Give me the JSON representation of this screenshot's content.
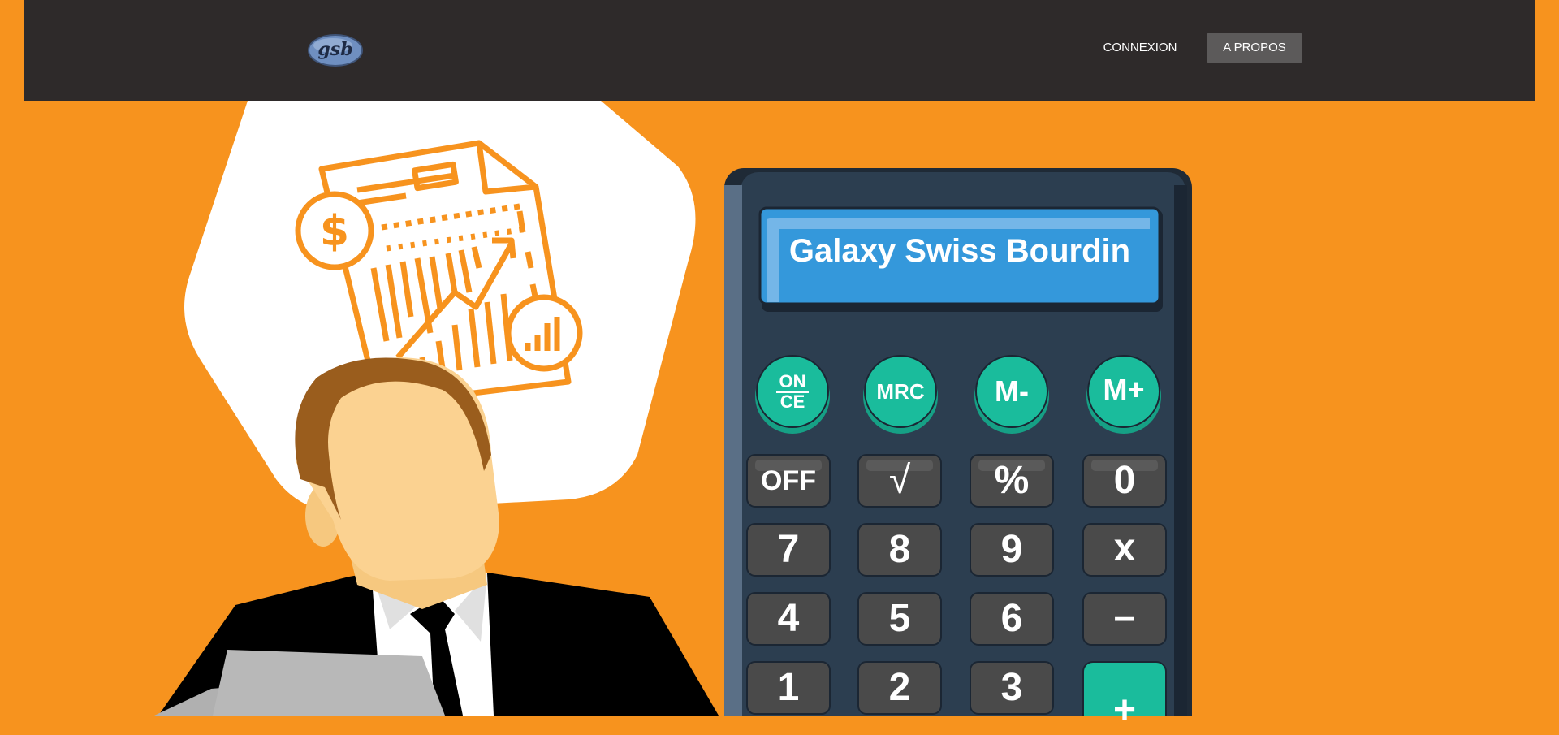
{
  "nav": {
    "logo_text": "gsb",
    "links": [
      {
        "label": "CONNEXION"
      },
      {
        "label": "A PROPOS"
      }
    ]
  },
  "calculator": {
    "display": "Galaxy Swiss Bourdin",
    "memory_keys": [
      {
        "label_top": "ON",
        "label_bottom": "CE"
      },
      {
        "label": "MRC"
      },
      {
        "label": "M-"
      },
      {
        "label": "M+"
      }
    ],
    "rows": [
      [
        "OFF",
        "√",
        "%",
        "0"
      ],
      [
        "7",
        "8",
        "9",
        "x"
      ],
      [
        "4",
        "5",
        "6",
        "–"
      ],
      [
        "1",
        "2",
        "3",
        "+"
      ]
    ]
  },
  "colors": {
    "background": "#f7931e",
    "navbar": "#2e2a2a",
    "calculator_body": "#2c3e50",
    "display": "#3498db",
    "teal_key": "#1abc9c",
    "dark_key": "#4a4a4a"
  }
}
